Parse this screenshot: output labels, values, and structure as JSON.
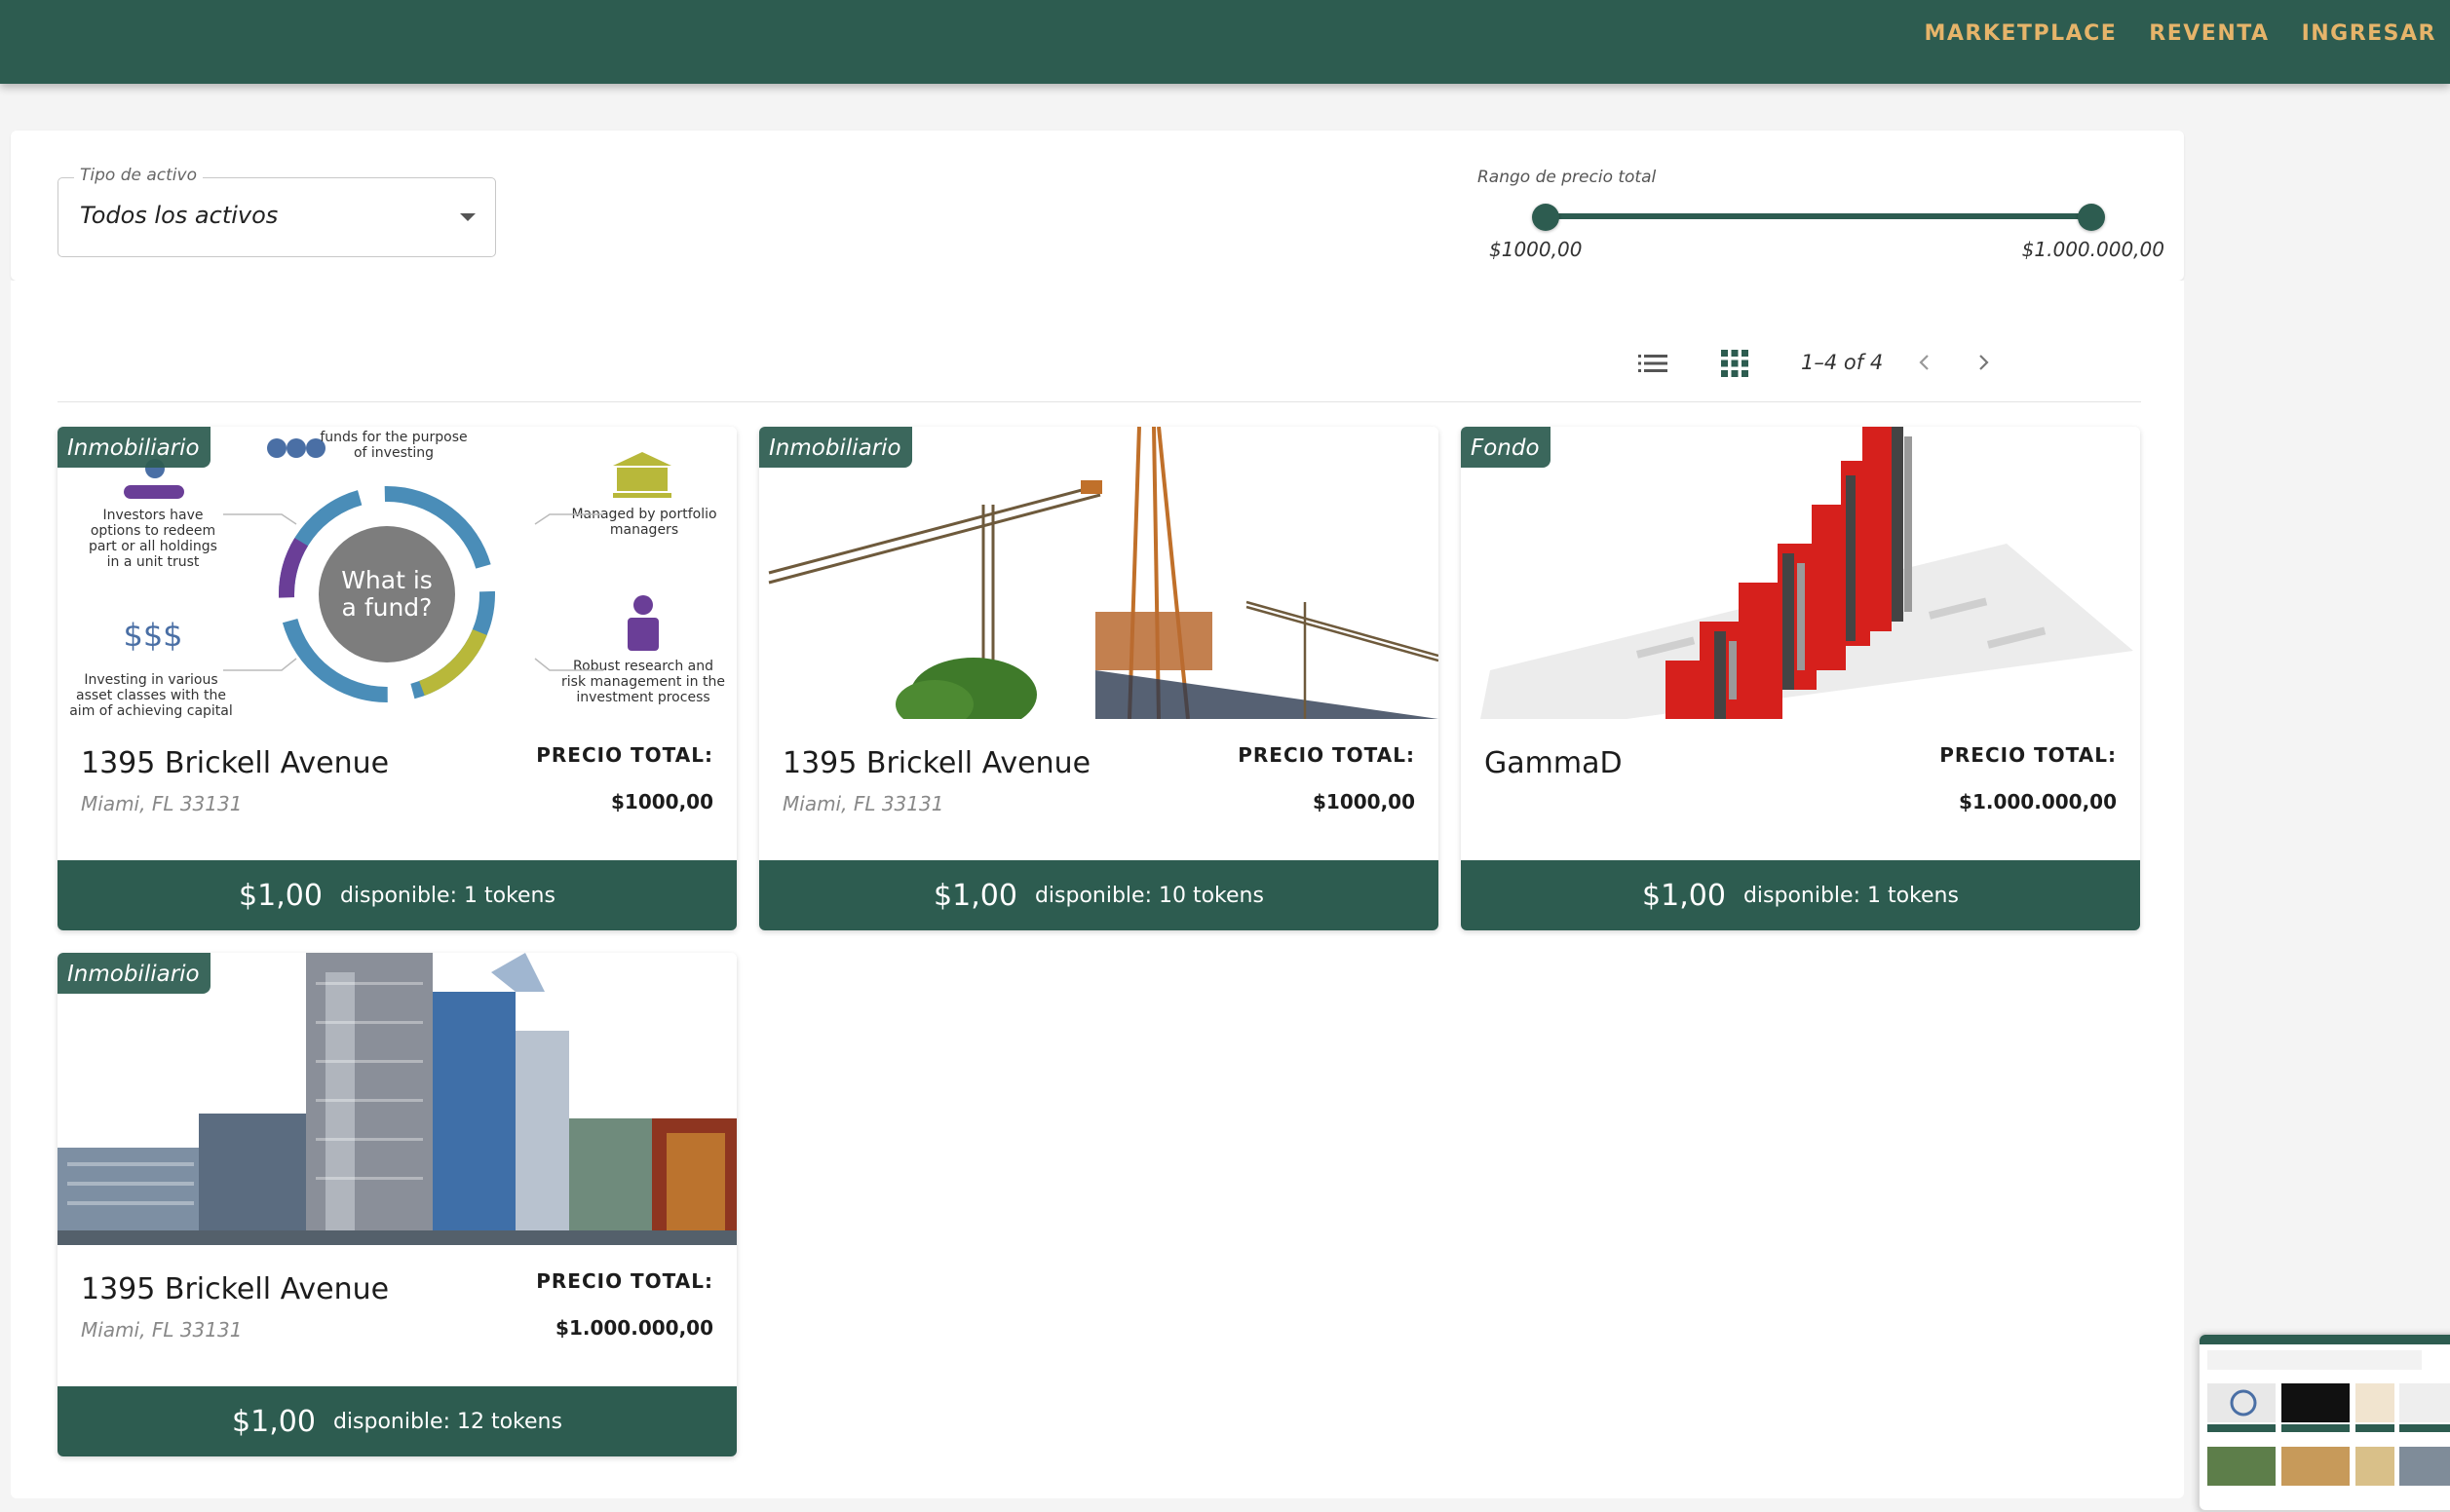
{
  "nav": {
    "marketplace": "MARKETPLACE",
    "reventa": "REVENTA",
    "ingresar": "INGRESAR"
  },
  "filters": {
    "asset_type_label": "Tipo de activo",
    "asset_type_value": "Todos los activos",
    "price_range_label": "Rango de precio total",
    "price_min": "$1000,00",
    "price_max": "$1.000.000,00"
  },
  "toolbar": {
    "pagination": "1–4 of 4"
  },
  "fund_graphic": {
    "center_line1": "What is",
    "center_line2": "a fund?",
    "t1a": "funds for the purpose",
    "t1b": "of investing",
    "t2a": "Managed by portfolio",
    "t2b": "managers",
    "t3a": "Robust research and",
    "t3b": "risk management in the",
    "t3c": "investment process",
    "t4a": "Investing in various",
    "t4b": "asset classes with the",
    "t4c": "aim of achieving capital",
    "t5a": "Investors have",
    "t5b": "options to redeem",
    "t5c": "part or all holdings",
    "t5d": "in a unit trust"
  },
  "cards": [
    {
      "badge": "Inmobiliario",
      "title": "1395 Brickell Avenue",
      "subtitle": "Miami, FL 33131",
      "price_label": "PRECIO TOTAL:",
      "price": "$1000,00",
      "token_price": "$1,00",
      "available": "disponible: 1 tokens"
    },
    {
      "badge": "Inmobiliario",
      "title": "1395 Brickell Avenue",
      "subtitle": "Miami, FL 33131",
      "price_label": "PRECIO TOTAL:",
      "price": "$1000,00",
      "token_price": "$1,00",
      "available": "disponible: 10 tokens"
    },
    {
      "badge": "Fondo",
      "title": "GammaD",
      "subtitle": "",
      "price_label": "PRECIO TOTAL:",
      "price": "$1.000.000,00",
      "token_price": "$1,00",
      "available": "disponible: 1 tokens"
    },
    {
      "badge": "Inmobiliario",
      "title": "1395 Brickell Avenue",
      "subtitle": "Miami, FL 33131",
      "price_label": "PRECIO TOTAL:",
      "price": "$1.000.000,00",
      "token_price": "$1,00",
      "available": "disponible: 12 tokens"
    }
  ],
  "icons": {
    "list_view": "list-view-icon",
    "grid_view": "grid-view-icon",
    "prev": "chevron-left-icon",
    "next": "chevron-right-icon",
    "dropdown": "caret-down-icon"
  },
  "colors": {
    "primary": "#2d5c50",
    "nav_text": "#e6b46a",
    "chart_red": "#d6201c"
  }
}
